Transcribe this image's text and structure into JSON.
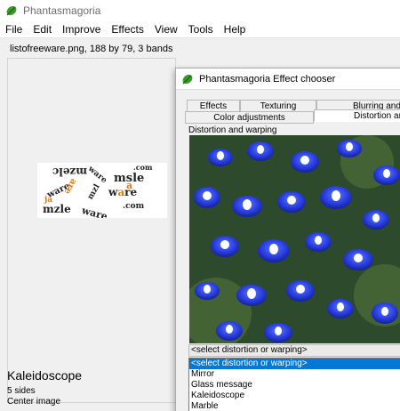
{
  "app": {
    "title": "Phantasmagoria",
    "icon": "leaf-icon"
  },
  "menu": [
    "File",
    "Edit",
    "Improve",
    "Effects",
    "View",
    "Tools",
    "Help"
  ],
  "image_panel": {
    "caption": "listofreeware.png, 188 by 79, 3 bands",
    "effect_name": "Kaleidoscope",
    "effect_param1": "5 sides",
    "effect_param2": "Center image"
  },
  "dialog": {
    "title": "Phantasmagoria Effect chooser",
    "tabs_row1": [
      "Effects",
      "Texturing",
      "Blurring and sh"
    ],
    "tabs_row2": [
      "Color adjustments",
      "Distortion and"
    ],
    "group_label": "Distortion and warping",
    "combo_value": "<select distortion or warping>",
    "dropdown_options": [
      "<select distortion or warping>",
      "Mirror",
      "Glass message",
      "Kaleidoscope",
      "Marble"
    ]
  },
  "colors": {
    "accent": "#0078d7",
    "title_text": "#6d6d6d"
  }
}
